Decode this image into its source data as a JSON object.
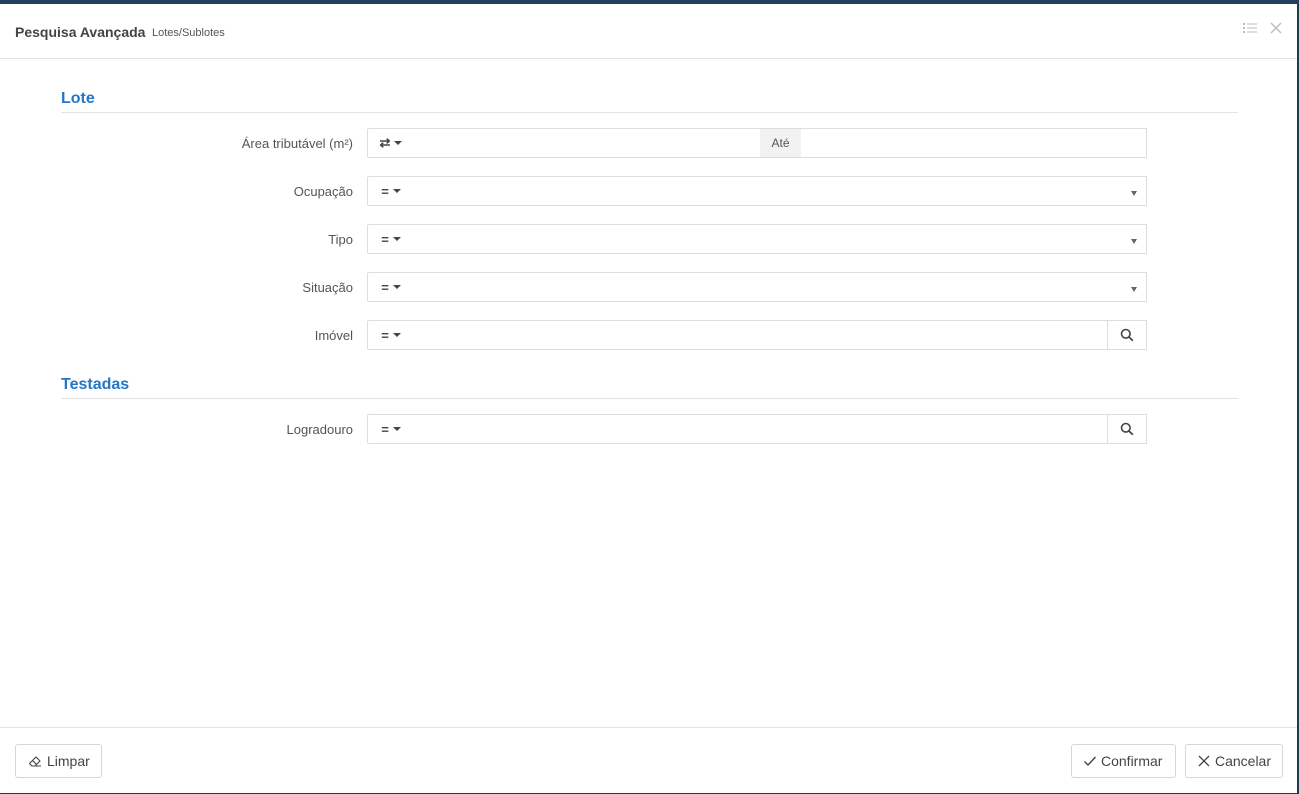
{
  "header": {
    "title": "Pesquisa Avançada",
    "subtitle": "Lotes/Sublotes",
    "list_icon": "list-icon",
    "close_icon": "close-icon"
  },
  "sections": {
    "lote": {
      "title": "Lote",
      "fields": [
        {
          "label": "Área tributável (m²)",
          "operator": "⇄",
          "type": "range",
          "range_separator": "Até",
          "value_from": "",
          "value_to": ""
        },
        {
          "label": "Ocupação",
          "operator": "=",
          "type": "select",
          "value": ""
        },
        {
          "label": "Tipo",
          "operator": "=",
          "type": "select",
          "value": ""
        },
        {
          "label": "Situação",
          "operator": "=",
          "type": "select",
          "value": ""
        },
        {
          "label": "Imóvel",
          "operator": "=",
          "type": "search",
          "value": ""
        }
      ]
    },
    "testadas": {
      "title": "Testadas",
      "fields": [
        {
          "label": "Logradouro",
          "operator": "=",
          "type": "search",
          "value": ""
        }
      ]
    }
  },
  "footer": {
    "clear_label": "Limpar",
    "confirm_label": "Confirmar",
    "cancel_label": "Cancelar"
  },
  "colors": {
    "accent": "#2476c6",
    "backdrop": "#1f3a55"
  }
}
